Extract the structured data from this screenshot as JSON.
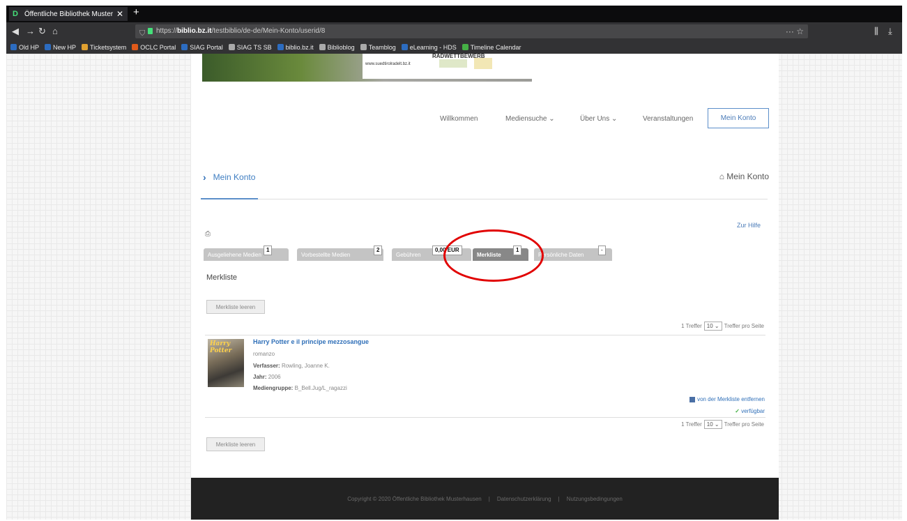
{
  "browser": {
    "tab_title": "Öffentliche Bibliothek Muster",
    "tab_close": "✕",
    "new_tab": "+",
    "url_prefix": "https://",
    "url_host": "biblio.bz.it",
    "url_path": "/testbiblio/de-de/Mein-Konto/userid/8",
    "url_rights": "··· ☆",
    "bookmarks": [
      {
        "label": "Old HP",
        "color": "#2c6cc0"
      },
      {
        "label": "New HP",
        "color": "#2c6cc0"
      },
      {
        "label": "Ticketsystem",
        "color": "#e0a030"
      },
      {
        "label": "OCLC Portal",
        "color": "#e05a1a"
      },
      {
        "label": "SIAG Portal",
        "color": "#2c6cc0"
      },
      {
        "label": "SIAG TS SB",
        "color": "#aaaaaa"
      },
      {
        "label": "biblio.bz.it",
        "color": "#2c6cc0"
      },
      {
        "label": "Biblioblog",
        "color": "#aaaaaa"
      },
      {
        "label": "Teamblog",
        "color": "#aaaaaa"
      },
      {
        "label": "eLearning - HDS",
        "color": "#2c6cc0"
      },
      {
        "label": "Timeline Calendar",
        "color": "#45b045"
      }
    ]
  },
  "banner": {
    "headline": "RADWETTBEWERB",
    "url": "www.suedtirolradelt.bz.it"
  },
  "mainnav": {
    "items": [
      "Willkommen",
      "Mediensuche ⌄",
      "Über Uns ⌄",
      "Veranstaltungen"
    ],
    "account": "Mein Konto"
  },
  "breadcrumb": {
    "label": "Mein Konto",
    "right": "Mein Konto"
  },
  "help_link": "Zur Hilfe",
  "tabs": [
    {
      "label": "Ausgeliehene Medien",
      "badge": "1",
      "active": false
    },
    {
      "label": "Vorbestellte Medien",
      "badge": "2",
      "active": false
    },
    {
      "label": "Gebühren",
      "badge": "0,00 EUR",
      "active": false
    },
    {
      "label": "Merkliste",
      "badge": "1",
      "active": true
    },
    {
      "label": "Persönliche Daten",
      "badge": "-",
      "active": false
    }
  ],
  "section_title": "Merkliste",
  "clear_button": "Merkliste leeren",
  "pager": {
    "hits": "1 Treffer",
    "per_page": "10",
    "suffix": "Treffer pro Seite"
  },
  "record": {
    "cover_text": "Harry Potter",
    "title": "Harry Potter e il principe mezzosangue",
    "subtitle": "romanzo",
    "author_label": "Verfasser:",
    "author": "Rowling, Joanne K.",
    "year_label": "Jahr:",
    "year": "2006",
    "group_label": "Mediengruppe:",
    "group": "B_Bell.Jug/L_ragazzi",
    "remove": "von der Merkliste entfernen",
    "availability": "verfügbar"
  },
  "footer": {
    "copyright": "Copyright © 2020 Öffentliche Bibliothek Musterhausen",
    "privacy": "Datenschutzerklärung",
    "terms": "Nutzungsbedingungen"
  },
  "colors": {
    "accent": "#4a7bb8",
    "highlight_circle": "#e10000"
  }
}
